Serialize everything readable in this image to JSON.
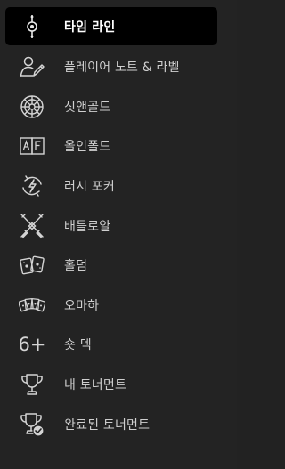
{
  "menu": {
    "items": [
      {
        "label": "타임 라인",
        "icon": "timeline-icon",
        "active": true
      },
      {
        "label": "플레이어 노트 & 라벨",
        "icon": "player-notes-icon",
        "active": false
      },
      {
        "label": "싯앤골드",
        "icon": "sit-and-go-icon",
        "active": false
      },
      {
        "label": "올인폴드",
        "icon": "all-in-fold-icon",
        "active": false
      },
      {
        "label": "러시 포커",
        "icon": "rush-poker-icon",
        "active": false
      },
      {
        "label": "배틀로얄",
        "icon": "battle-royale-icon",
        "active": false
      },
      {
        "label": "홀덤",
        "icon": "holdem-cards-icon",
        "active": false
      },
      {
        "label": "오마하",
        "icon": "omaha-cards-icon",
        "active": false
      },
      {
        "label": "숏 덱",
        "icon": "short-deck-icon",
        "icon_text": "6+",
        "active": false
      },
      {
        "label": "내 토너먼트",
        "icon": "trophy-icon",
        "active": false
      },
      {
        "label": "완료된 토너먼트",
        "icon": "trophy-check-icon",
        "active": false
      }
    ]
  },
  "colors": {
    "background": "#232323",
    "active_background": "#000000",
    "active_text": "#ffffff",
    "text": "#cfcfcf",
    "icon": "#d4d4d4"
  }
}
